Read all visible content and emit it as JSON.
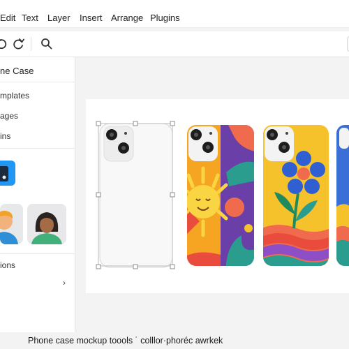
{
  "menubar": {
    "items": [
      "Edit",
      "Text",
      "Layer",
      "Insert",
      "Arrange",
      "Plugins"
    ]
  },
  "toolbar": {
    "icons": [
      "undo-icon",
      "redo-icon",
      "search-icon"
    ]
  },
  "sidebar": {
    "title": "ne Case",
    "links": [
      "mplates",
      "ages",
      "ins"
    ],
    "section_label": "ions",
    "section_chevron": "›"
  },
  "canvas": {
    "phones": [
      {
        "name": "blank-white-case",
        "color": "#f8f8f8",
        "selected": true
      },
      {
        "name": "sun-design-case",
        "color": "#f0a020"
      },
      {
        "name": "flower-design-case",
        "color": "#f6c22b"
      },
      {
        "name": "partial-case",
        "color": "#3b6fd8"
      }
    ]
  },
  "caption": "Phone case mockup toools ˙ colllor·phoréc awrkek",
  "colors": {
    "accent": "#2196f3",
    "selection": "#9a9a9a"
  }
}
